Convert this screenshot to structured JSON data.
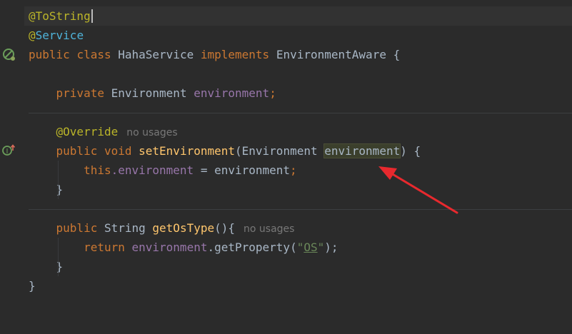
{
  "code": {
    "l1": {
      "ann": "@ToString"
    },
    "l2": {
      "ann_at": "@",
      "ann_name": "Service"
    },
    "l3": {
      "kw_public": "public",
      "kw_class": "class",
      "name": "HahaService",
      "kw_impl": "implements",
      "iface": "EnvironmentAware",
      "brace": "{"
    },
    "l5": {
      "kw_private": "private",
      "type": "Environment",
      "field": "environment",
      "semi": ";"
    },
    "l7": {
      "ann": "@Override",
      "hint": "no usages"
    },
    "l8": {
      "kw_public": "public",
      "kw_void": "void",
      "method": "setEnvironment",
      "open": "(",
      "type": "Environment",
      "param": "environment",
      "close": ") {"
    },
    "l9": {
      "kw_this": "this",
      "dot_field": ".environment",
      "rest": " = environment",
      "semi": ";"
    },
    "l10": {
      "brace": "}"
    },
    "l12": {
      "kw_public": "public",
      "type": "String",
      "method": "getOsType",
      "rest": "(){",
      "hint": "no usages"
    },
    "l13": {
      "kw_return": "return",
      "field": "environment",
      "call": ".getProperty(",
      "q1": "\"",
      "str": "OS",
      "q2": "\"",
      "end": ");"
    },
    "l14": {
      "brace": "}"
    },
    "l15": {
      "brace": "}"
    }
  },
  "gutter_icons": [
    "no-entry-icon",
    "implemented-method-icon"
  ],
  "colors": {
    "arrow": "#e8292e",
    "background": "#2b2b2b"
  }
}
